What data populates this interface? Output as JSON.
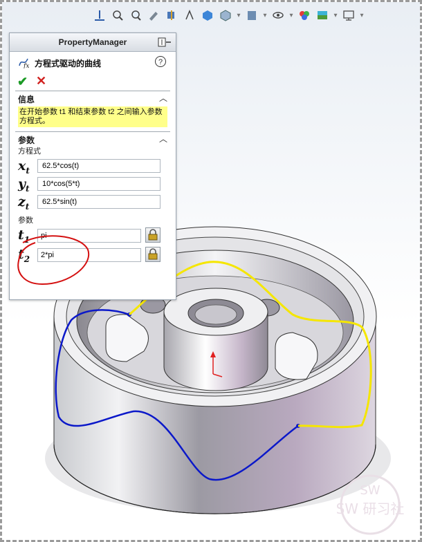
{
  "property_manager": {
    "header_title": "PropertyManager",
    "feature_title": "方程式驱动的曲线",
    "help_glyph": "?",
    "ok_glyph": "✔",
    "cancel_glyph": "✕",
    "info_section": {
      "title": "信息",
      "text": "在开始参数 t1 和结束参数 t2 之间输入参数方程式。"
    },
    "params_section": {
      "title": "参数",
      "equation_label": "方程式",
      "equations": [
        {
          "var": "x",
          "sub": "t",
          "value": "62.5*cos(t)"
        },
        {
          "var": "y",
          "sub": "t",
          "value": "10*cos(5*t)"
        },
        {
          "var": "z",
          "sub": "t",
          "value": "62.5*sin(t)"
        }
      ],
      "param_label": "参数",
      "params": [
        {
          "var": "t",
          "sub": "1",
          "value": "pi"
        },
        {
          "var": "t",
          "sub": "2",
          "value": "2*pi"
        }
      ]
    }
  },
  "colors": {
    "curve_blue": "#0b18c9",
    "curve_yellow": "#f5e600",
    "annotation_red": "#d41010",
    "info_background": "#ffff8a"
  },
  "watermark": {
    "text": "SW 研习社"
  }
}
